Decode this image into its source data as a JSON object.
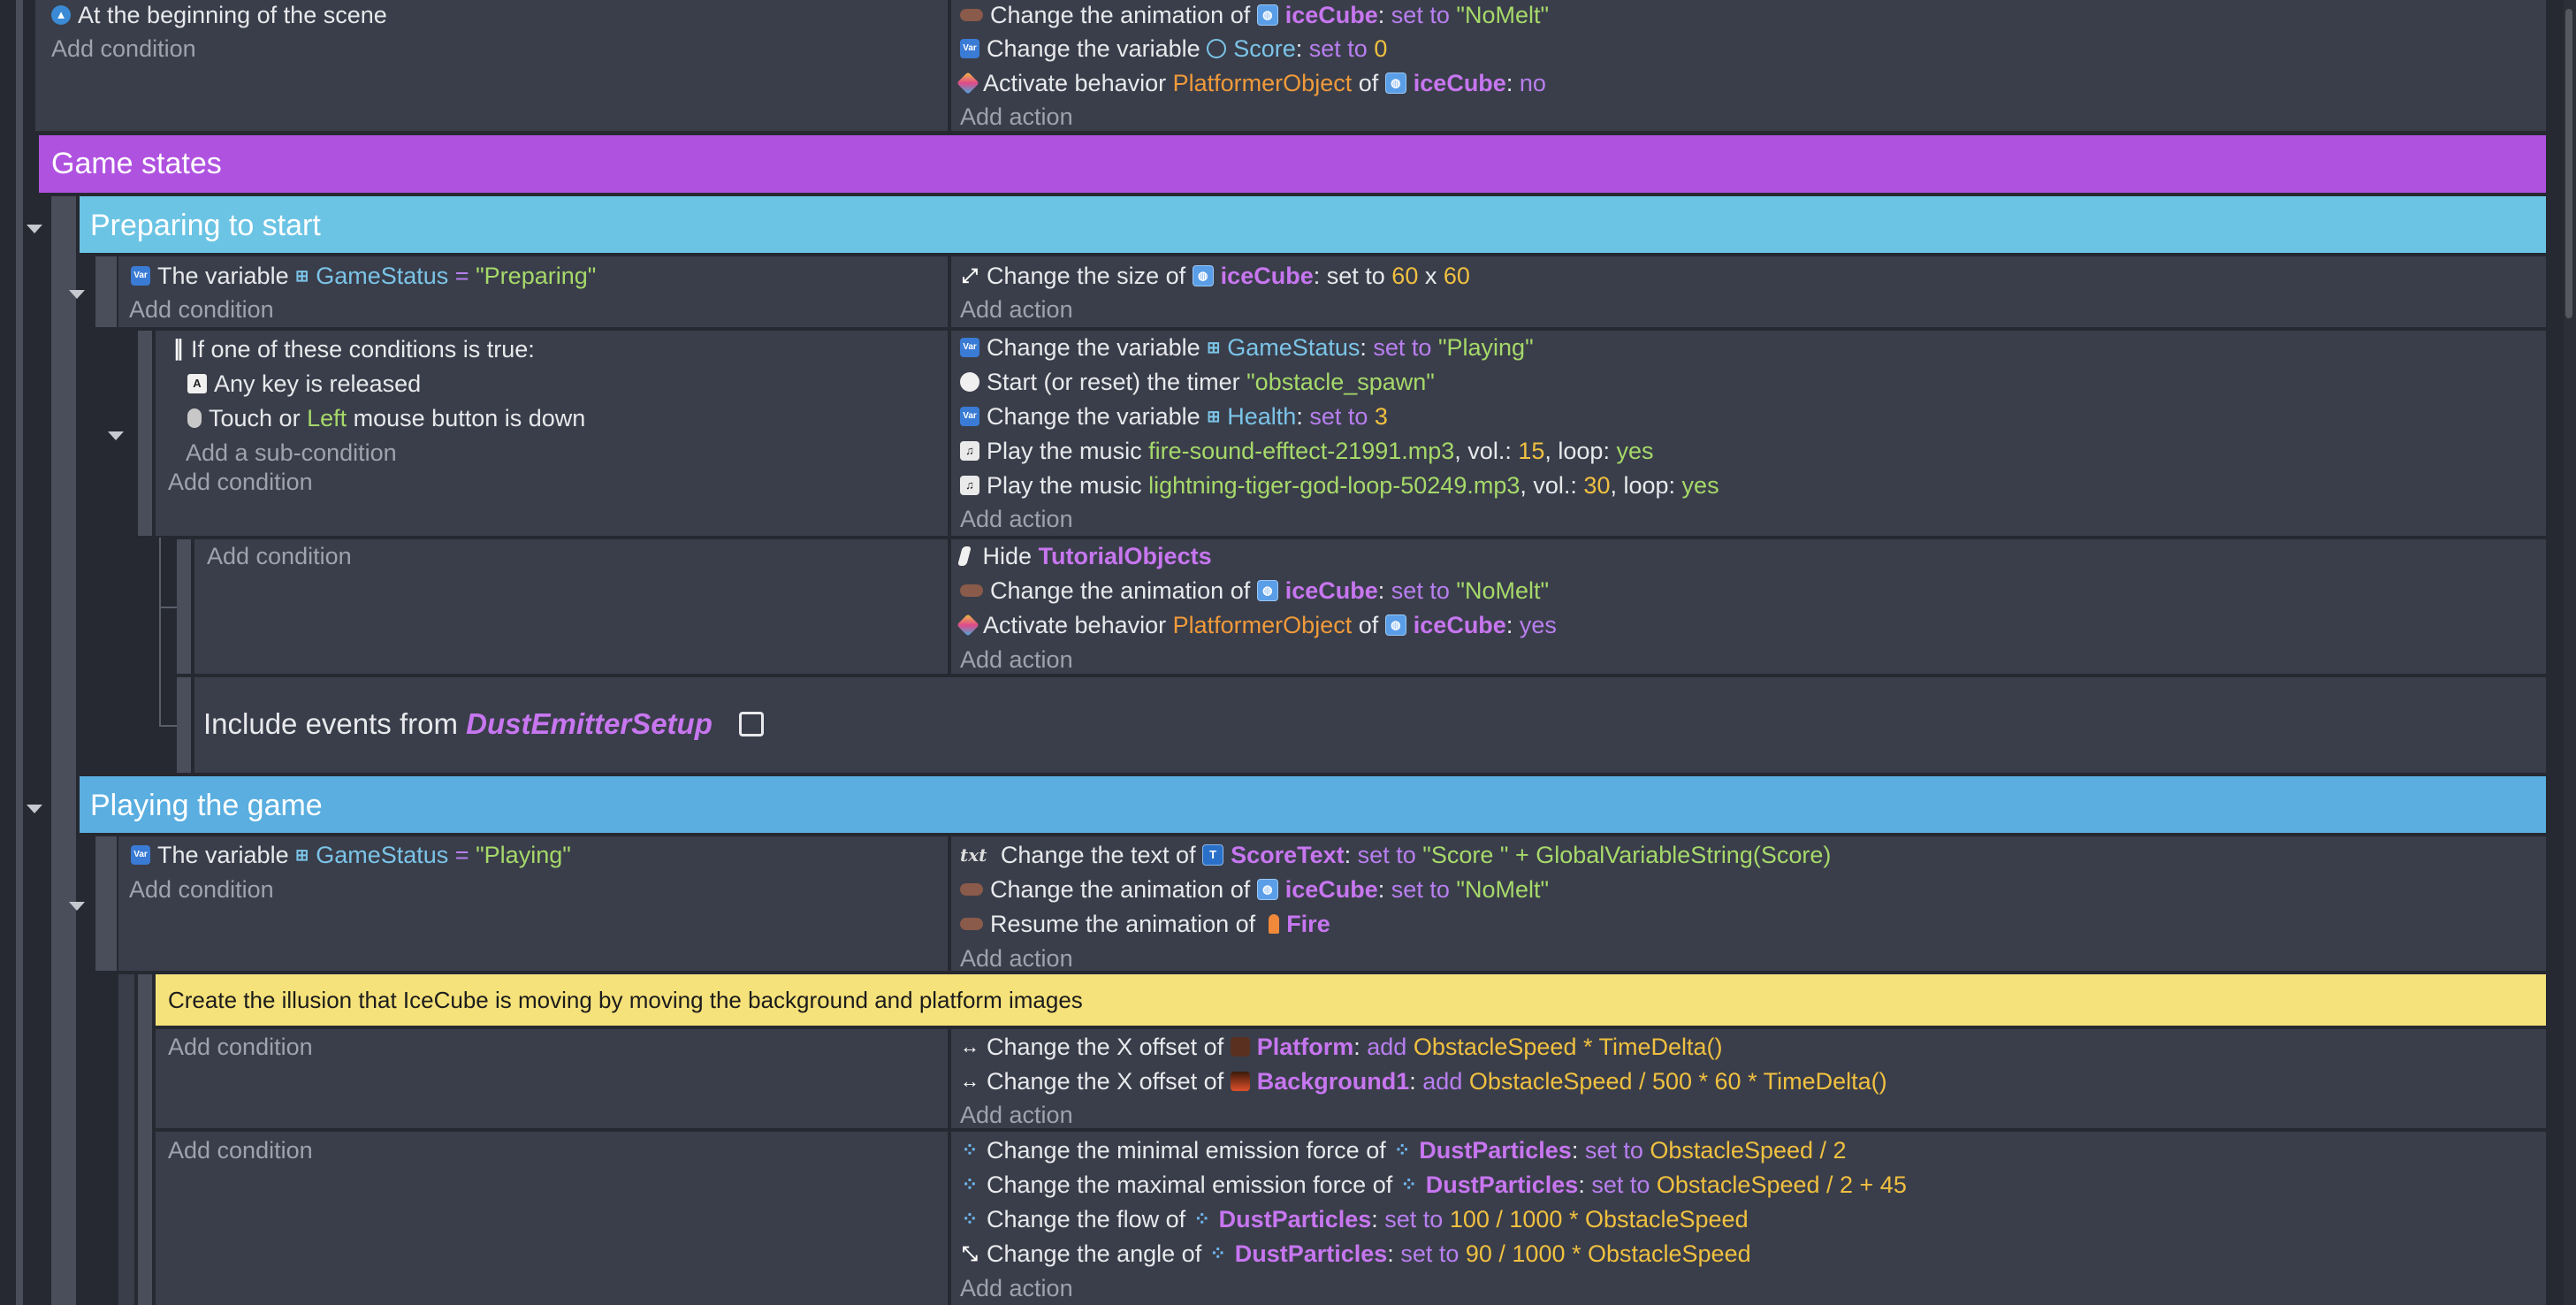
{
  "common": {
    "add_condition": "Add condition",
    "add_action": "Add action",
    "add_subcondition": "Add a sub-condition"
  },
  "ev1": {
    "cond": "At the beginning of the scene",
    "a1": {
      "pre": "Change the animation of",
      "obj": "iceCube",
      "op": "set to",
      "val": "\"NoMelt\""
    },
    "a2": {
      "pre": "Change the variable",
      "var": "Score",
      "op": "set to",
      "val": "0"
    },
    "a3": {
      "pre": "Activate behavior",
      "beh": "PlatformerObject",
      "of": "of",
      "obj": "iceCube",
      "val": "no"
    }
  },
  "groups": {
    "game_states": "Game states",
    "preparing": "Preparing to start",
    "playing": "Playing the game"
  },
  "ev2": {
    "cond": {
      "pre": "The variable",
      "var": "GameStatus",
      "eq": "=",
      "val": "\"Preparing\""
    },
    "a1": {
      "pre": "Change the size of",
      "obj": "iceCube",
      "mid": "set to",
      "w": "60",
      "x": "x",
      "h": "60"
    }
  },
  "ev3": {
    "or": "If one of these conditions is true:",
    "c1": "Any key is released",
    "c2": {
      "pre": "Touch or",
      "btn": "Left",
      "post": "mouse button is down"
    },
    "a1": {
      "pre": "Change the variable",
      "var": "GameStatus",
      "op": "set to",
      "val": "\"Playing\""
    },
    "a2": {
      "pre": "Start (or reset) the timer",
      "val": "\"obstacle_spawn\""
    },
    "a3": {
      "pre": "Change the variable",
      "var": "Health",
      "op": "set to",
      "val": "3"
    },
    "a4": {
      "pre": "Play the music",
      "file": "fire-sound-efftect-21991.mp3",
      "vol": ", vol.:",
      "volv": "15",
      "loop": ", loop:",
      "loopv": "yes"
    },
    "a5": {
      "pre": "Play the music",
      "file": "lightning-tiger-god-loop-50249.mp3",
      "vol": ", vol.:",
      "volv": "30",
      "loop": ", loop:",
      "loopv": "yes"
    }
  },
  "ev4": {
    "a1": {
      "pre": "Hide",
      "obj": "TutorialObjects"
    },
    "a2": {
      "pre": "Change the animation of",
      "obj": "iceCube",
      "op": "set to",
      "val": "\"NoMelt\""
    },
    "a3": {
      "pre": "Activate behavior",
      "beh": "PlatformerObject",
      "of": "of",
      "obj": "iceCube",
      "val": "yes"
    }
  },
  "include": {
    "pre": "Include events from",
    "name": "DustEmitterSetup"
  },
  "ev5": {
    "cond": {
      "pre": "The variable",
      "var": "GameStatus",
      "eq": "=",
      "val": "\"Playing\""
    },
    "a1": {
      "pre": "Change the text of",
      "obj": "ScoreText",
      "op": "set to",
      "val": "\"Score \" + GlobalVariableString(Score)"
    },
    "a2": {
      "pre": "Change the animation of",
      "obj": "iceCube",
      "op": "set to",
      "val": "\"NoMelt\""
    },
    "a3": {
      "pre": "Resume the animation of",
      "obj": "Fire"
    }
  },
  "comment": "Create the illusion that IceCube is moving by moving the background and platform images",
  "ev6": {
    "a1": {
      "pre": "Change the X offset of",
      "obj": "Platform",
      "op": "add",
      "val": "ObstacleSpeed * TimeDelta()"
    },
    "a2": {
      "pre": "Change the X offset of",
      "obj": "Background1",
      "op": "add",
      "val": "ObstacleSpeed / 500 * 60 * TimeDelta()"
    }
  },
  "ev7": {
    "a1": {
      "pre": "Change the minimal emission force of",
      "obj": "DustParticles",
      "op": "set to",
      "val": "ObstacleSpeed / 2"
    },
    "a2": {
      "pre": "Change the maximal emission force of",
      "obj": "DustParticles",
      "op": "set to",
      "val": "ObstacleSpeed / 2 + 45"
    },
    "a3": {
      "pre": "Change the flow of",
      "obj": "DustParticles",
      "op": "set to",
      "val": "100 / 1000 * ObstacleSpeed"
    },
    "a4": {
      "pre": "Change the angle of",
      "obj": "DustParticles",
      "op": "set to",
      "val": "90 / 1000 * ObstacleSpeed"
    }
  },
  "colors": {
    "game_states": "#b052e0",
    "preparing": "#6cc4e4",
    "playing": "#5aaee0",
    "comment": "#f6e27a",
    "panel": "#3a3e4a",
    "bg": "#262931"
  },
  "icons": [
    "scene-icon",
    "variable-icon",
    "animation-icon",
    "behavior-icon",
    "object-icon",
    "resize-icon",
    "key-icon",
    "mouse-icon",
    "timer-icon",
    "music-icon",
    "hide-icon",
    "text-icon",
    "fire-icon",
    "platform-icon",
    "background-icon",
    "particles-icon",
    "offset-icon",
    "angle-icon",
    "external-link-icon"
  ]
}
